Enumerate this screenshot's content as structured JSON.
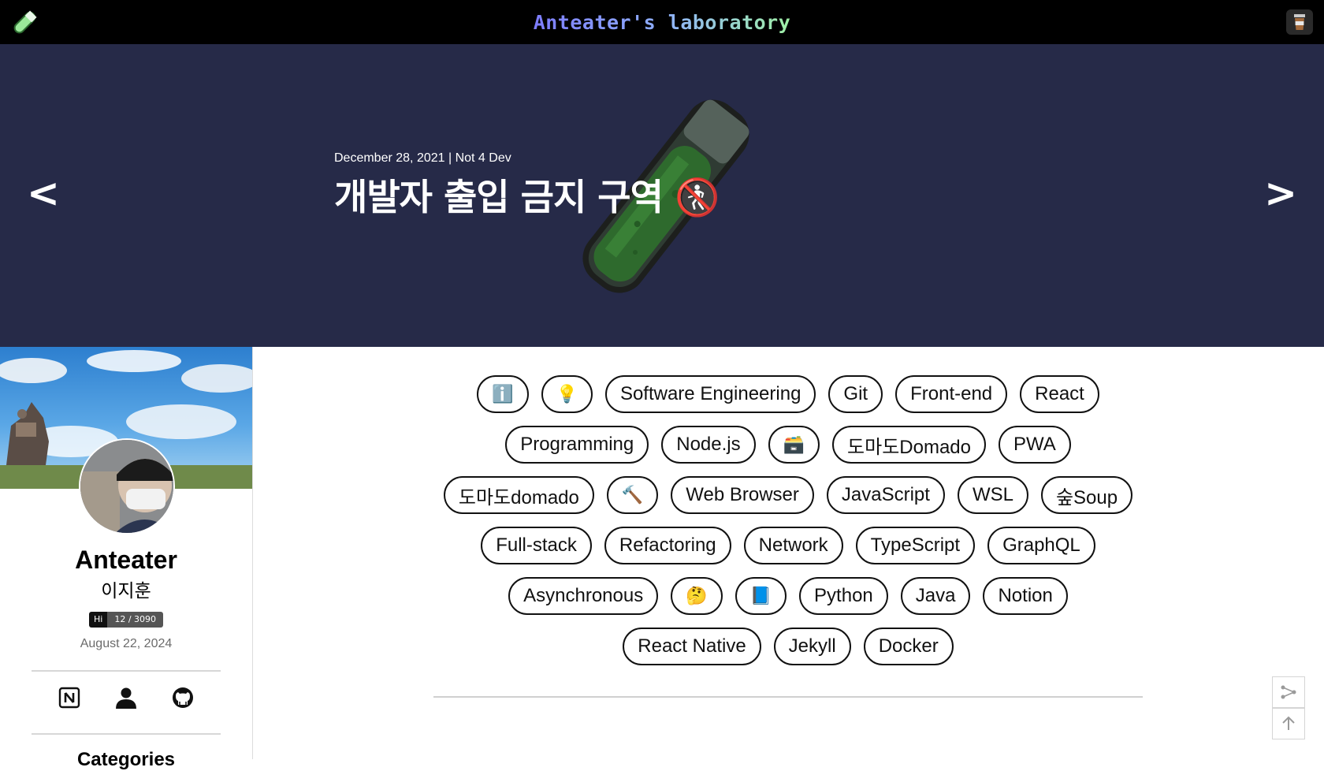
{
  "header": {
    "title": "Anteater's laboratory",
    "logo_icon": "test-tube-icon",
    "right_icon": "coffee-cup-icon"
  },
  "hero": {
    "meta": "December 28, 2021 | Not 4 Dev",
    "title": "개발자 출입 금지 구역 🚷",
    "prev_label": "<",
    "next_label": ">",
    "background": "#262a48"
  },
  "profile": {
    "name": "Anteater",
    "korean_name": "이지훈",
    "hits_label": "Hi",
    "hits_value": "12 / 3090",
    "date": "August 22, 2024",
    "social_icons": [
      "notion-icon",
      "person-icon",
      "github-icon"
    ],
    "categories_title": "Categories"
  },
  "tags": [
    "ℹ️",
    "💡",
    "Software Engineering",
    "Git",
    "Front-end",
    "React",
    "Programming",
    "Node.js",
    "🗃️",
    "도마도Domado",
    "PWA",
    "도마도domado",
    "🔨",
    "Web Browser",
    "JavaScript",
    "WSL",
    "숲Soup",
    "Full-stack",
    "Refactoring",
    "Network",
    "TypeScript",
    "GraphQL",
    "Asynchronous",
    "🤔",
    "📘",
    "Python",
    "Java",
    "Notion",
    "React Native",
    "Jekyll",
    "Docker"
  ],
  "floating": {
    "share_icon": "share-icon",
    "top_icon": "arrow-up-icon"
  }
}
